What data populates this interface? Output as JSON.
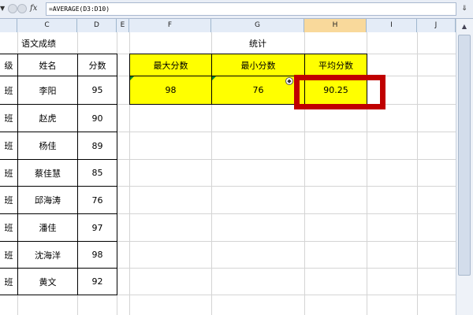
{
  "formula_bar": {
    "formula": "=AVERAGE(D3:D10)",
    "fx_label": "fx",
    "name_box_arrow": "▼",
    "expand_symbol": "⇓"
  },
  "columns": [
    "C",
    "D",
    "E",
    "F",
    "G",
    "H",
    "I",
    "J"
  ],
  "active_column": "H",
  "left_table": {
    "title": "语文成绩",
    "headers": {
      "class": "级",
      "name": "姓名",
      "score": "分数"
    },
    "rows": [
      {
        "class": "班",
        "name": "李阳",
        "score": "95"
      },
      {
        "class": "班",
        "name": "赵虎",
        "score": "90"
      },
      {
        "class": "班",
        "name": "杨佳",
        "score": "89"
      },
      {
        "class": "班",
        "name": "蔡佳慧",
        "score": "85"
      },
      {
        "class": "班",
        "name": "邱海涛",
        "score": "76"
      },
      {
        "class": "班",
        "name": "潘佳",
        "score": "97"
      },
      {
        "class": "班",
        "name": "沈海洋",
        "score": "98"
      },
      {
        "class": "班",
        "name": "黄文",
        "score": "92"
      }
    ]
  },
  "stats_table": {
    "title": "统计",
    "headers": {
      "max": "最大分数",
      "min": "最小分数",
      "avg": "平均分数"
    },
    "values": {
      "max": "98",
      "min": "76",
      "avg": "90.25"
    }
  },
  "colors": {
    "highlight": "#ffff00",
    "selection_box": "#c00000",
    "active_header": "#f9d99b"
  },
  "icons": {
    "paste_options": "paste-options-icon",
    "scroll_up": "▲"
  }
}
